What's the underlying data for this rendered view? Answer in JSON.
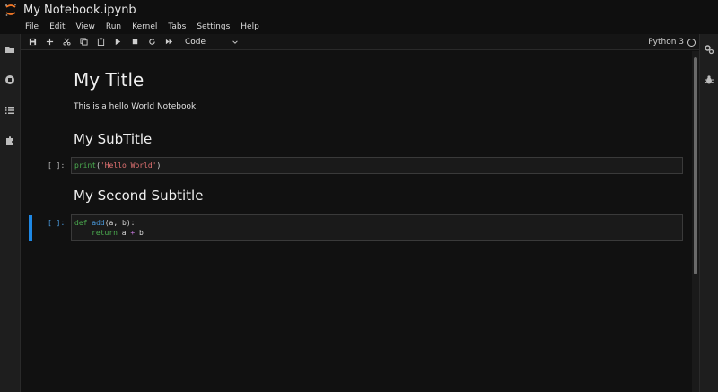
{
  "window": {
    "title": "My Notebook.ipynb"
  },
  "menu": [
    "File",
    "Edit",
    "View",
    "Run",
    "Kernel",
    "Tabs",
    "Settings",
    "Help"
  ],
  "toolbar": {
    "cell_type": "Code",
    "kernel": "Python 3"
  },
  "sidebar_left": [
    "folder-icon",
    "stop-circle-icon",
    "list-icon",
    "puzzle-icon"
  ],
  "sidebar_right": [
    "gears-icon",
    "bug-icon"
  ],
  "notebook": {
    "title": "My Title",
    "paragraph": "This is a hello World Notebook",
    "subtitle1": "My SubTitle",
    "subtitle2": "My Second Subtitle",
    "cell1": {
      "prompt": "[ ]:",
      "func": "print",
      "open": "(",
      "string": "'Hello World'",
      "close": ")"
    },
    "cell2": {
      "prompt": "[ ]:",
      "kw_def": "def",
      "fname": "add",
      "sig": "(a, b):",
      "kw_return": "return",
      "a": "a",
      "op": "+",
      "b": "b"
    }
  },
  "colors": {
    "accent": "#1e88e5",
    "keyword": "#4caf50",
    "string": "#e57373",
    "function": "#4a9ce0"
  }
}
